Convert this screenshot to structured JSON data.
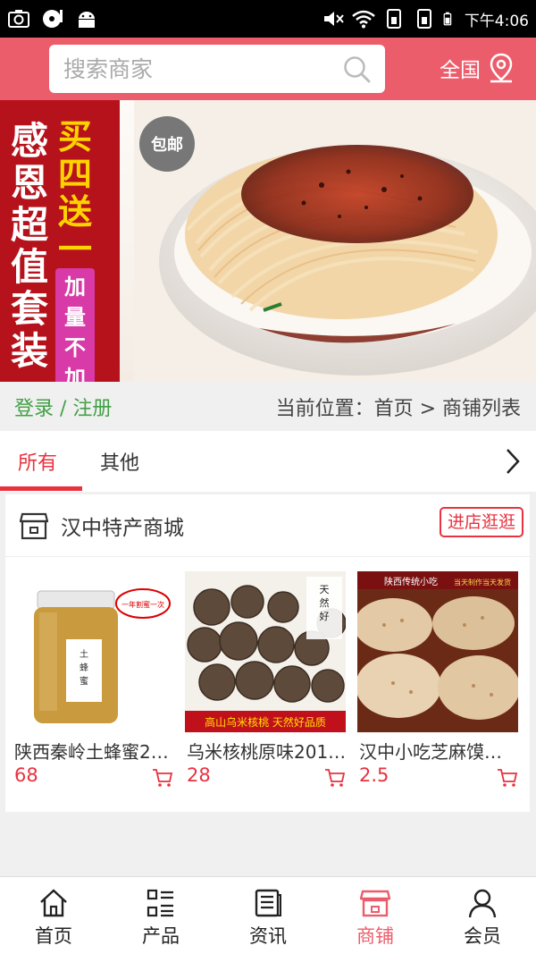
{
  "status_bar": {
    "time": "下午4:06",
    "icons": [
      "camera-icon",
      "disc-icon",
      "android-icon",
      "mute-icon",
      "wifi-icon",
      "sim1-icon",
      "sim2-icon",
      "battery-icon"
    ]
  },
  "header": {
    "search_placeholder": "搜索商家",
    "region_label": "全国"
  },
  "banner": {
    "text_main": "感恩超值套装",
    "text_promo": "买四送一",
    "text_extra": "加量不加价",
    "badge": "包邮"
  },
  "breadcrumb": {
    "login_label": "登录 / 注册",
    "location": "当前位置：首页 > 商铺列表"
  },
  "tabs": [
    {
      "label": "所有",
      "active": true
    },
    {
      "label": "其他",
      "active": false
    }
  ],
  "store": {
    "name": "汉中特产商城",
    "visit_label": "进店逛逛",
    "products": [
      {
        "name": "陕西秦岭土蜂蜜2…",
        "price": "68"
      },
      {
        "name": "乌米核桃原味201…",
        "price": "28"
      },
      {
        "name": "汉中小吃芝麻馍…",
        "price": "2.5"
      }
    ]
  },
  "bottom_nav": [
    {
      "label": "首页",
      "icon": "home-icon",
      "active": false
    },
    {
      "label": "产品",
      "icon": "grid-list-icon",
      "active": false
    },
    {
      "label": "资讯",
      "icon": "news-icon",
      "active": false
    },
    {
      "label": "商铺",
      "icon": "store-icon",
      "active": true
    },
    {
      "label": "会员",
      "icon": "user-icon",
      "active": false
    }
  ],
  "colors": {
    "accent": "#ec5d6c",
    "price": "#e8323f",
    "login": "#43a047"
  }
}
